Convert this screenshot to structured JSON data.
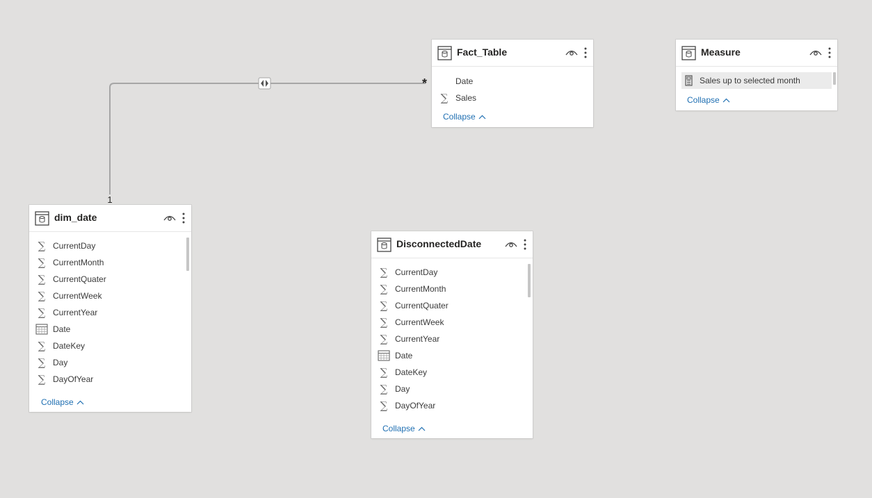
{
  "relationship": {
    "from_cardinality": "1",
    "to_cardinality": "*"
  },
  "tables": {
    "fact": {
      "title": "Fact_Table",
      "fields": [
        {
          "label": "Date",
          "icon": "none"
        },
        {
          "label": "Sales",
          "icon": "sigma-icon"
        }
      ],
      "collapse_label": "Collapse"
    },
    "measure": {
      "title": "Measure",
      "fields": [
        {
          "label": "Sales up to selected month",
          "icon": "calculator-icon"
        }
      ],
      "collapse_label": "Collapse"
    },
    "dim_date": {
      "title": "dim_date",
      "fields": [
        {
          "label": "CurrentDay",
          "icon": "sigma-icon"
        },
        {
          "label": "CurrentMonth",
          "icon": "sigma-icon"
        },
        {
          "label": "CurrentQuater",
          "icon": "sigma-icon"
        },
        {
          "label": "CurrentWeek",
          "icon": "sigma-icon"
        },
        {
          "label": "CurrentYear",
          "icon": "sigma-icon"
        },
        {
          "label": "Date",
          "icon": "calendar-icon"
        },
        {
          "label": "DateKey",
          "icon": "sigma-icon"
        },
        {
          "label": "Day",
          "icon": "sigma-icon"
        },
        {
          "label": "DayOfYear",
          "icon": "sigma-icon"
        }
      ],
      "collapse_label": "Collapse"
    },
    "disconnected": {
      "title": "DisconnectedDate",
      "fields": [
        {
          "label": "CurrentDay",
          "icon": "sigma-icon"
        },
        {
          "label": "CurrentMonth",
          "icon": "sigma-icon"
        },
        {
          "label": "CurrentQuater",
          "icon": "sigma-icon"
        },
        {
          "label": "CurrentWeek",
          "icon": "sigma-icon"
        },
        {
          "label": "CurrentYear",
          "icon": "sigma-icon"
        },
        {
          "label": "Date",
          "icon": "calendar-icon"
        },
        {
          "label": "DateKey",
          "icon": "sigma-icon"
        },
        {
          "label": "Day",
          "icon": "sigma-icon"
        },
        {
          "label": "DayOfYear",
          "icon": "sigma-icon"
        }
      ],
      "collapse_label": "Collapse"
    }
  },
  "colors": {
    "canvas": "#e1e0df",
    "link": "#1f6fb2",
    "line": "#a6a6a6"
  }
}
